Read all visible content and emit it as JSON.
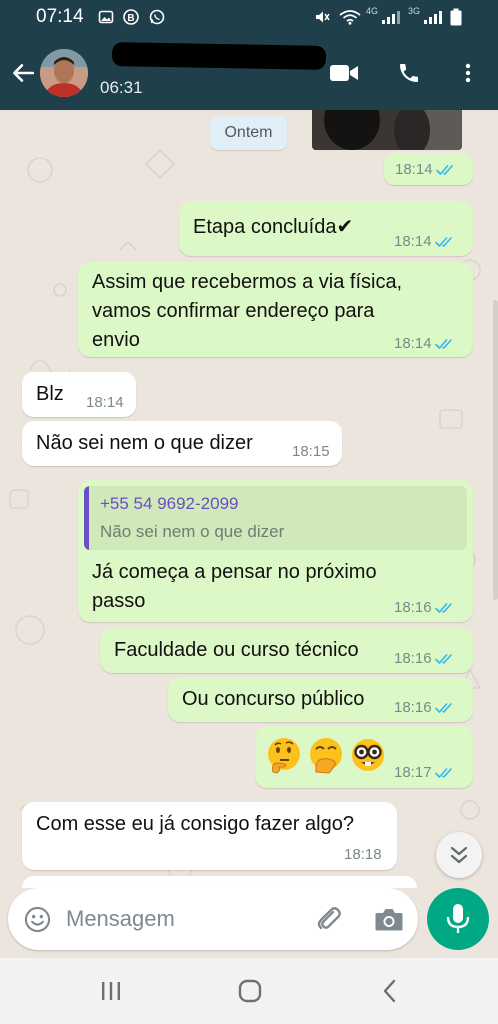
{
  "status_bar": {
    "time": "07:14",
    "net_a": "4G",
    "net_b": "3G"
  },
  "header": {
    "subtitle": "06:31"
  },
  "date_chip": "Ontem",
  "messages": [
    {
      "time": "18:14"
    },
    {
      "text": "Etapa concluída✔",
      "time": "18:14"
    },
    {
      "text": "Assim que recebermos a via física,\nvamos confirmar endereço para\nenvio",
      "time": "18:14"
    },
    {
      "text": "Blz",
      "time": "18:14"
    },
    {
      "text": "Não sei nem o que dizer",
      "time": "18:15"
    },
    {
      "quote_name": "+55 54 9692-2099",
      "quote_text": "Não sei nem o que dizer",
      "text": "Já começa a pensar no próximo\npasso",
      "time": "18:16"
    },
    {
      "text": "Faculdade ou curso técnico",
      "time": "18:16"
    },
    {
      "text": "Ou concurso público",
      "time": "18:16"
    },
    {
      "emojis": [
        "thinking-face",
        "face-with-hand-over-mouth",
        "nerd-face"
      ],
      "time": "18:17"
    },
    {
      "text": "Com esse eu já consigo fazer algo?",
      "time": "18:18"
    }
  ],
  "composer": {
    "placeholder": "Mensagem"
  },
  "colors": {
    "header": "#1f3f4a",
    "outgoing": "#dcf8c6",
    "incoming": "#ffffff",
    "accent": "#00a884",
    "read_ticks": "#34b7f1",
    "quote_name": "#6a4fc4"
  },
  "icons": [
    "back-arrow-icon",
    "video-call-icon",
    "phone-icon",
    "more-vert-icon",
    "emoji-icon",
    "attach-icon",
    "camera-icon",
    "mic-icon",
    "scroll-down-icon",
    "nav-recent-icon",
    "nav-home-icon",
    "nav-back-icon"
  ]
}
